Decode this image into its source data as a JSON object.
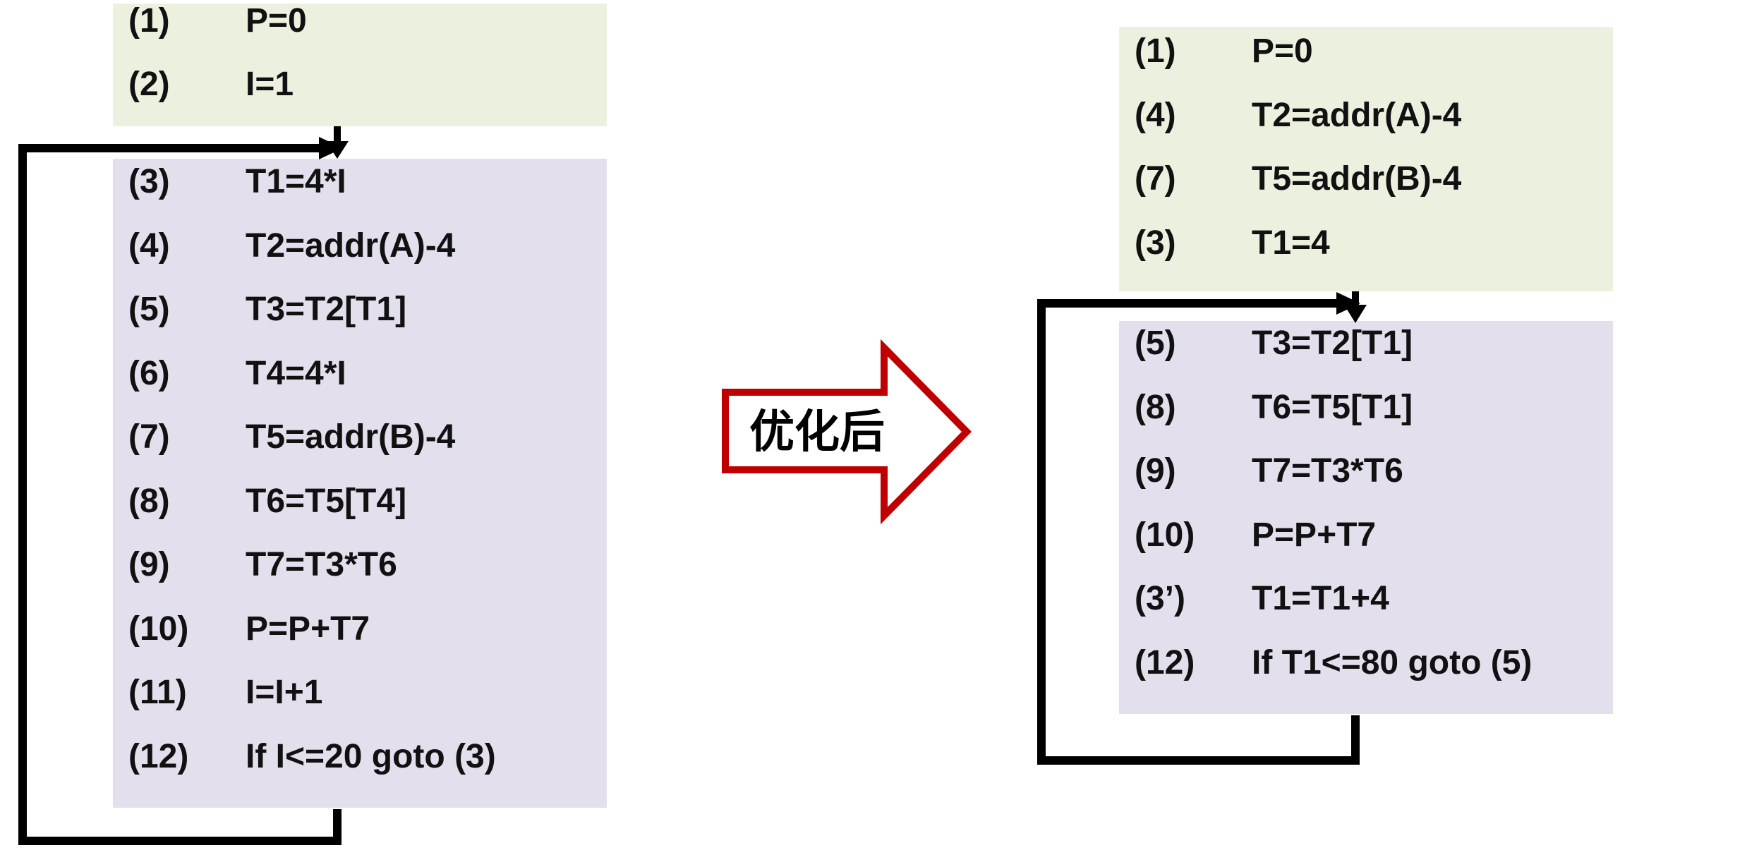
{
  "left": {
    "init_block": [
      {
        "num": "(1)",
        "code": "P=0"
      },
      {
        "num": "(2)",
        "code": "I=1"
      }
    ],
    "loop_block": [
      {
        "num": "(3)",
        "code": "T1=4*I"
      },
      {
        "num": "(4)",
        "code": "T2=addr(A)-4"
      },
      {
        "num": "(5)",
        "code": "T3=T2[T1]"
      },
      {
        "num": "(6)",
        "code": "T4=4*I"
      },
      {
        "num": "(7)",
        "code": "T5=addr(B)-4"
      },
      {
        "num": "(8)",
        "code": "T6=T5[T4]"
      },
      {
        "num": "(9)",
        "code": "T7=T3*T6"
      },
      {
        "num": "(10)",
        "code": "P=P+T7"
      },
      {
        "num": "(11)",
        "code": "I=I+1"
      },
      {
        "num": "(12)",
        "code": "If I<=20 goto (3)"
      }
    ]
  },
  "arrow": {
    "label": "优化后"
  },
  "right": {
    "init_block": [
      {
        "num": "(1)",
        "code": "P=0"
      },
      {
        "num": "(4)",
        "code": "T2=addr(A)-4"
      },
      {
        "num": "(7)",
        "code": "T5=addr(B)-4"
      },
      {
        "num": "(3)",
        "code": "T1=4"
      }
    ],
    "loop_block": [
      {
        "num": "(5)",
        "code": "T3=T2[T1]"
      },
      {
        "num": "(8)",
        "code": "T6=T5[T1]"
      },
      {
        "num": "(9)",
        "code": "T7=T3*T6"
      },
      {
        "num": "(10)",
        "code": "P=P+T7"
      },
      {
        "num": "(3’)",
        "code": "T1=T1+4"
      },
      {
        "num": "(12)",
        "code": "If T1<=80 goto (5)"
      }
    ]
  },
  "colors": {
    "init_block": "#ebf1de",
    "loop_block": "#e4dfec",
    "arrow_outline": "#c00000"
  }
}
